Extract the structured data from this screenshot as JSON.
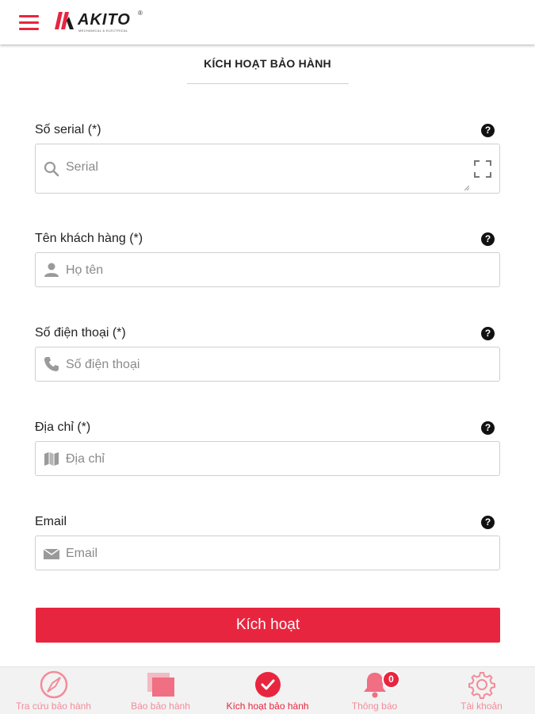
{
  "header": {
    "menu_icon": "hamburger-menu-icon",
    "logo": {
      "text": "AKITO",
      "subtitle": "MECHANICAL & ELECTRICAL",
      "registered": "®"
    }
  },
  "page": {
    "title": "KÍCH HOẠT BẢO HÀNH"
  },
  "form": {
    "fields": [
      {
        "label": "Số serial (*)",
        "placeholder": "Serial",
        "icon": "search-icon",
        "help_icon": "question-circle-icon",
        "extra_icon": "scan-icon"
      },
      {
        "label": "Tên khách hàng (*)",
        "placeholder": "Họ tên",
        "icon": "user-icon",
        "help_icon": "question-circle-icon"
      },
      {
        "label": "Số điện thoại (*)",
        "placeholder": "Số điện thoại",
        "icon": "phone-icon",
        "help_icon": "question-circle-icon"
      },
      {
        "label": "Địa chỉ (*)",
        "placeholder": "Địa chỉ",
        "icon": "map-icon",
        "help_icon": "question-circle-icon"
      },
      {
        "label": "Email",
        "placeholder": "Email",
        "icon": "envelope-icon",
        "help_icon": "question-circle-icon"
      }
    ],
    "help_glyph": "?",
    "submit_label": "Kích hoạt"
  },
  "tabbar": {
    "tabs": [
      {
        "label": "Tra cứu bảo hành",
        "icon": "compass-icon",
        "active": false
      },
      {
        "label": "Báo bảo hành",
        "icon": "cards-icon",
        "active": false
      },
      {
        "label": "Kích hoạt bảo hành",
        "icon": "check-circle-icon",
        "active": true
      },
      {
        "label": "Thông báo",
        "icon": "bell-icon",
        "active": false,
        "badge": "0"
      },
      {
        "label": "Tài khoản",
        "icon": "gear-icon",
        "active": false
      }
    ]
  },
  "colors": {
    "accent": "#e8253f",
    "inactive_tab": "#f28c9b",
    "border": "#cfcfcf",
    "placeholder": "#8a8a8a"
  }
}
